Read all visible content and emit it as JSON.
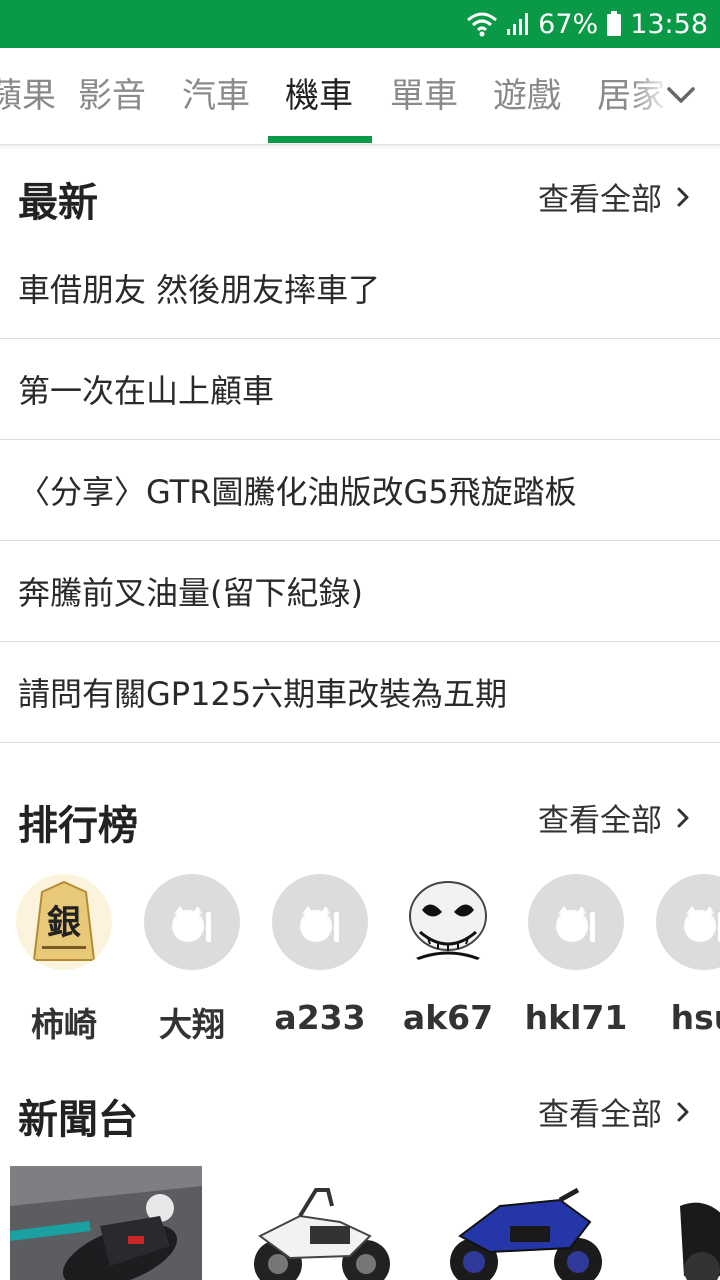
{
  "status": {
    "battery": "67%",
    "time": "13:58"
  },
  "tabs": [
    "蘋果",
    "影音",
    "汽車",
    "機車",
    "單車",
    "遊戲",
    "居家"
  ],
  "active_tab": "機車",
  "latest": {
    "title": "最新",
    "view_all": "查看全部",
    "items": [
      "車借朋友 然後朋友摔車了",
      "第一次在山上顧車",
      "〈分享〉GTR圖騰化油版改G5飛旋踏板",
      "奔騰前叉油量(留下紀錄)",
      "請問有關GP125六期車改裝為五期"
    ]
  },
  "ranking": {
    "title": "排行榜",
    "view_all": "查看全部",
    "users": [
      {
        "name": "柿崎",
        "avatar": "shogi-piece-avatar"
      },
      {
        "name": "大翔",
        "avatar": "default-avatar"
      },
      {
        "name": "a233",
        "avatar": "default-avatar"
      },
      {
        "name": "ak67",
        "avatar": "skull-avatar"
      },
      {
        "name": "hkl71",
        "avatar": "default-avatar"
      },
      {
        "name": "hsu",
        "avatar": "default-avatar"
      }
    ]
  },
  "newsroom": {
    "title": "新聞台",
    "view_all": "查看全部"
  },
  "colors": {
    "brand": "#0a9a47"
  }
}
